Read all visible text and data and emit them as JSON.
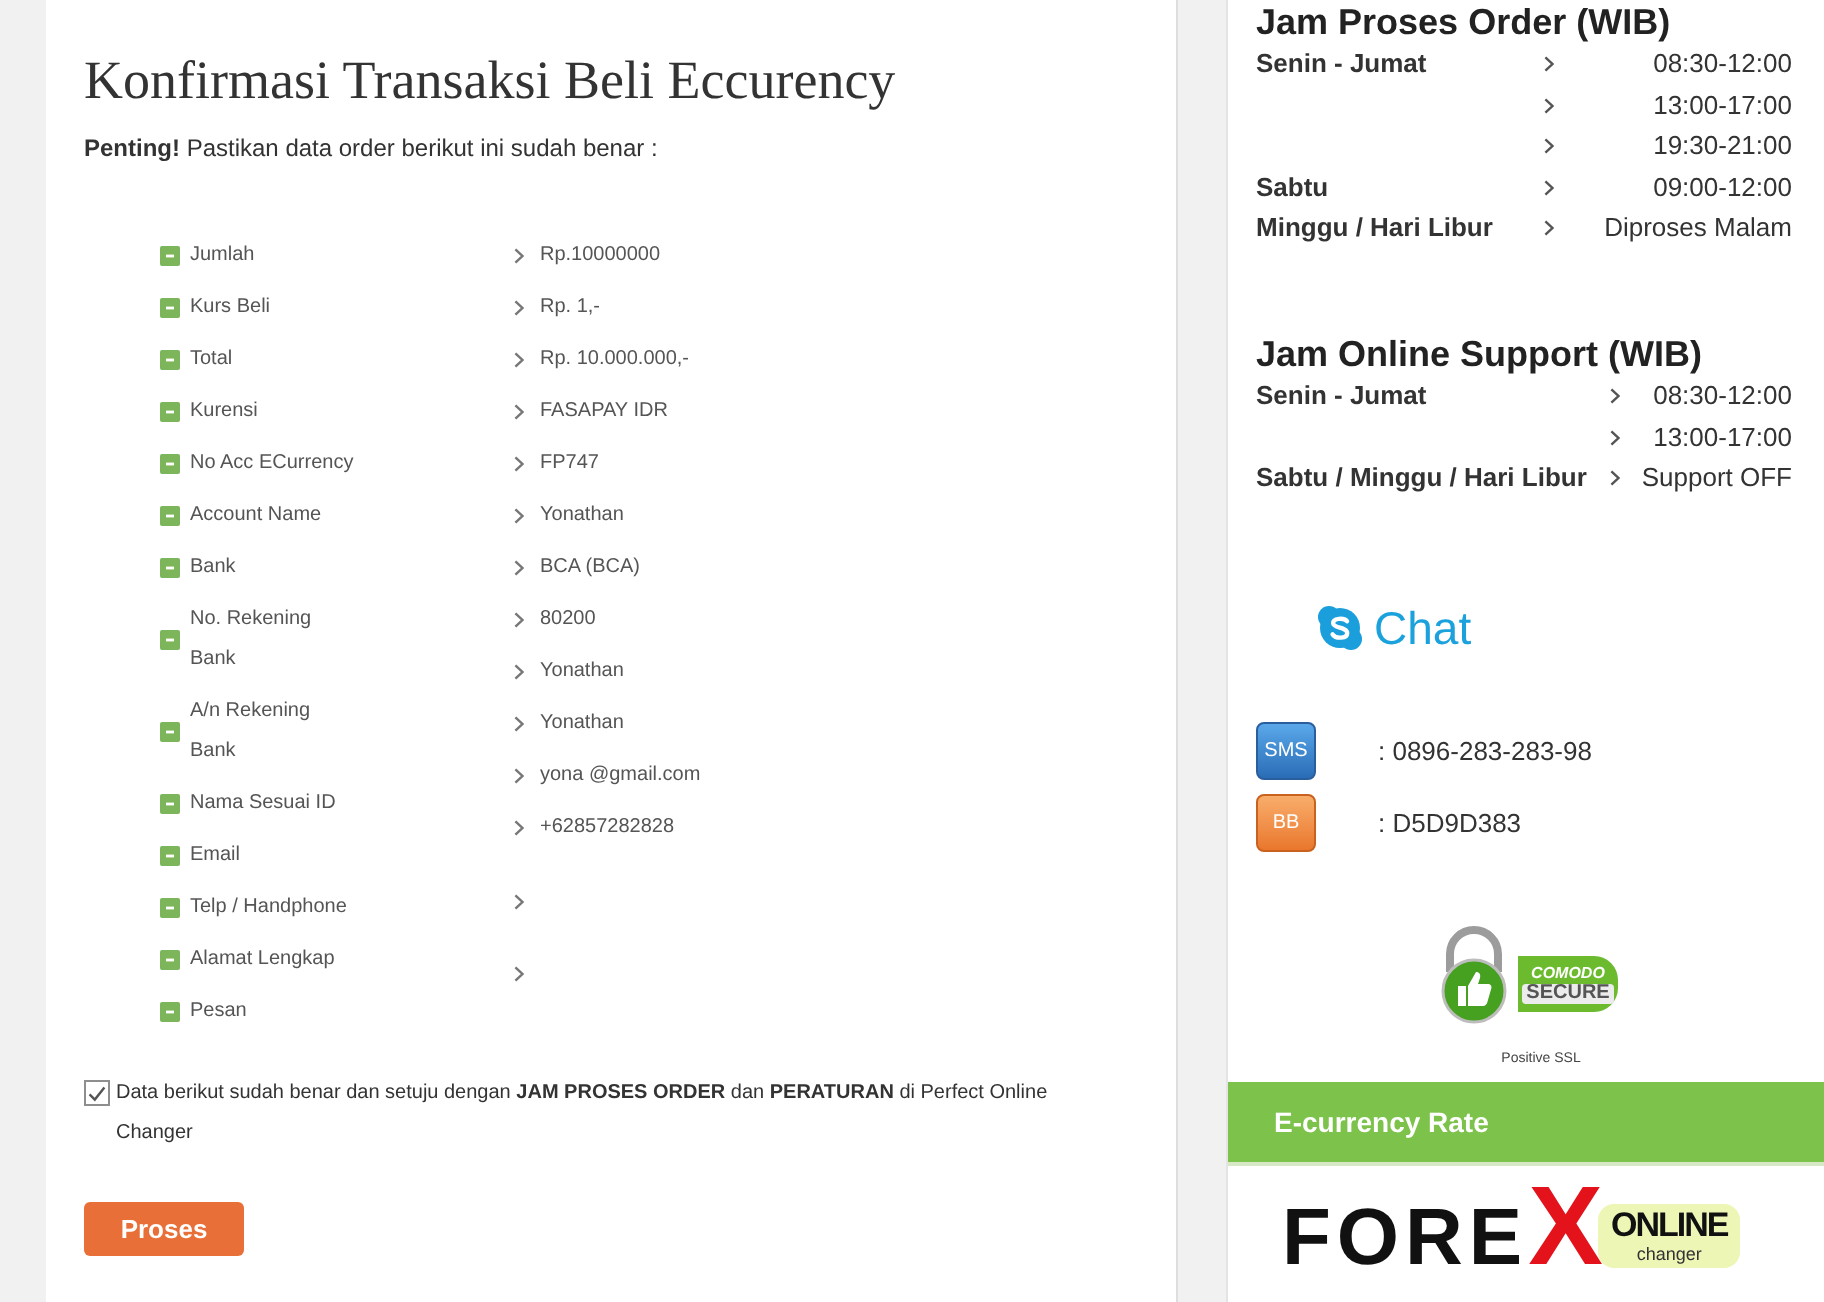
{
  "page": {
    "title": "Konfirmasi Transaksi Beli Eccurency",
    "notice": "**Penting!** Pastikan data order berikut ini sudah benar :"
  },
  "order_labels": [
    "Jumlah",
    "Kurs Beli",
    "Total",
    "Kurensi",
    "No Acc ECurrency",
    "Account Name",
    "Bank",
    "No. Rekening\nBank",
    "A/n Rekening\nBank",
    "Nama Sesuai ID",
    "Email",
    "Telp / Handphone",
    "Alamat Lengkap",
    "Pesan"
  ],
  "order_values": [
    {
      "kind": "text",
      "value": "Rp.10000000"
    },
    {
      "kind": "text",
      "value": "Rp. 1,-"
    },
    {
      "kind": "text",
      "value": "Rp. 10.000.000,-"
    },
    {
      "kind": "text",
      "value": "FASAPAY IDR"
    },
    {
      "kind": "text",
      "value": "FP747"
    },
    {
      "kind": "text",
      "value": "Yonathan"
    },
    {
      "kind": "text",
      "value": "BCA (BCA)"
    },
    {
      "kind": "text",
      "value": "80200"
    },
    {
      "kind": "text",
      "value": "Yonathan"
    },
    {
      "kind": "text",
      "value": "Yonathan"
    },
    {
      "kind": "text",
      "value": "yona @gmail.com"
    },
    {
      "kind": "text",
      "value": "+62857282828"
    },
    {
      "kind": "blank"
    },
    {
      "kind": "blank"
    }
  ],
  "confirm": {
    "checked": true,
    "text": "Data berikut sudah benar dan setuju dengan **JAM PROSES ORDER** dan **PERATURAN** di Perfect Online Changer"
  },
  "submit_button": {
    "label": "Proses"
  },
  "sidebar": {
    "order_hours": {
      "title": "Jam Proses Order (WIB)",
      "rows": [
        {
          "day": "Senin - Jumat",
          "time": "08:30-12:00"
        },
        {
          "time": "13:00-17:00"
        },
        {
          "time": "19:30-21:00"
        },
        {
          "day": "Sabtu",
          "time": "09:00-12:00"
        },
        {
          "day": "Minggu / Hari Libur",
          "time": "Diproses Malam"
        }
      ]
    },
    "support_hours": {
      "title": "Jam Online Support (WIB)",
      "rows": [
        {
          "day": "Senin - Jumat",
          "time": "08:30-12:00"
        },
        {
          "time": "13:00-17:00"
        },
        {
          "day": "Sabtu / Minggu / Hari Libur",
          "time": "Support OFF"
        }
      ]
    },
    "chat": {
      "label": "Chat"
    },
    "contacts": [
      {
        "kind": "sms",
        "tag": "SMS",
        "value": ": 0896-283-283-98"
      },
      {
        "kind": "bb",
        "tag": "BB",
        "value": ": D5D9D383"
      }
    ],
    "ssl_seal": {
      "brand": "COMODO",
      "status": "SECURE",
      "caption": "Positive SSL"
    },
    "rate_header": {
      "title": "E-currency Rate"
    },
    "logo": {
      "brand": "FORE",
      "brand_accent": "X",
      "tag": "ONLINE",
      "subtitle": "changer"
    }
  }
}
